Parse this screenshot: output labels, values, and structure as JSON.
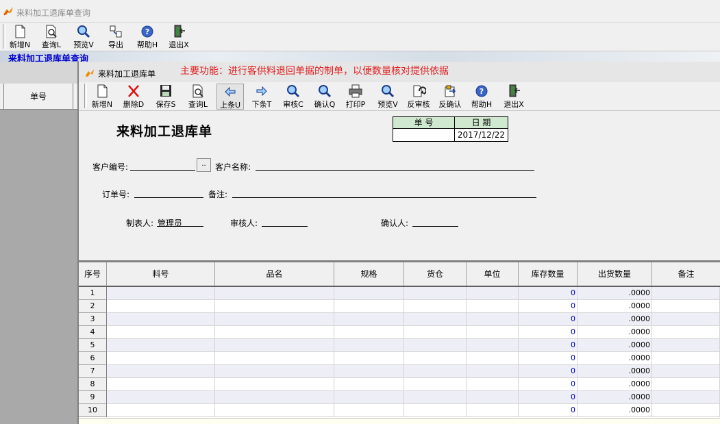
{
  "window": {
    "title": "来料加工退库单查询"
  },
  "outer_toolbar": {
    "buttons": [
      {
        "label": "新增N",
        "icon": "new-document-icon"
      },
      {
        "label": "查询L",
        "icon": "query-document-icon"
      },
      {
        "label": "预览V",
        "icon": "magnifier-icon"
      },
      {
        "label": "导出",
        "icon": "export-icon"
      },
      {
        "label": "帮助H",
        "icon": "help-icon"
      },
      {
        "label": "退出X",
        "icon": "exit-door-icon"
      }
    ]
  },
  "outer_panel": {
    "caption": "来料加工退库单查询",
    "grid_header": "单号"
  },
  "child": {
    "title": "来料加工退库单",
    "function_note": "主要功能：进行客供料退回单据的制单，以便数量核对提供依据",
    "toolbar": {
      "buttons": [
        {
          "label": "新增N",
          "icon": "new-document-icon"
        },
        {
          "label": "删除D",
          "icon": "delete-x-icon"
        },
        {
          "label": "保存S",
          "icon": "save-disk-icon"
        },
        {
          "label": "查询L",
          "icon": "query-document-icon"
        },
        {
          "label": "上条U",
          "icon": "arrow-left-icon"
        },
        {
          "label": "下条T",
          "icon": "arrow-right-icon"
        },
        {
          "label": "审核C",
          "icon": "magnifier-icon"
        },
        {
          "label": "确认Q",
          "icon": "magnifier-icon"
        },
        {
          "label": "打印P",
          "icon": "printer-icon"
        },
        {
          "label": "预览V",
          "icon": "magnifier-icon"
        },
        {
          "label": "反审核",
          "icon": "reverse-audit-icon"
        },
        {
          "label": "反确认",
          "icon": "reverse-confirm-icon"
        },
        {
          "label": "帮助H",
          "icon": "help-icon"
        },
        {
          "label": "退出X",
          "icon": "exit-door-icon"
        }
      ]
    },
    "form": {
      "title": "来料加工退库单",
      "doc_no_label": "单  号",
      "date_label": "日  期",
      "doc_no_value": "",
      "date_value": "2017/12/22",
      "customer_code_label": "客户编号:",
      "customer_code_value": "",
      "browse_label": "..",
      "customer_name_label": "客户名称:",
      "customer_name_value": "",
      "order_no_label": "订单号:",
      "order_no_value": "",
      "remark_label": "备注:",
      "remark_value": "",
      "maker_label": "制表人:",
      "maker_value": "管理员",
      "auditor_label": "审核人:",
      "auditor_value": "",
      "confirmer_label": "确认人:",
      "confirmer_value": ""
    },
    "grid": {
      "columns": [
        "序号",
        "料号",
        "品名",
        "规格",
        "货仓",
        "单位",
        "库存数量",
        "出货数量",
        "备注"
      ],
      "rows": [
        {
          "no": "1",
          "stock": "0",
          "qty": ".0000"
        },
        {
          "no": "2",
          "stock": "0",
          "qty": ".0000"
        },
        {
          "no": "3",
          "stock": "0",
          "qty": ".0000"
        },
        {
          "no": "4",
          "stock": "0",
          "qty": ".0000"
        },
        {
          "no": "5",
          "stock": "0",
          "qty": ".0000"
        },
        {
          "no": "6",
          "stock": "0",
          "qty": ".0000"
        },
        {
          "no": "7",
          "stock": "0",
          "qty": ".0000"
        },
        {
          "no": "8",
          "stock": "0",
          "qty": ".0000"
        },
        {
          "no": "9",
          "stock": "0",
          "qty": ".0000"
        },
        {
          "no": "10",
          "stock": "0",
          "qty": ".0000"
        }
      ]
    }
  },
  "colors": {
    "header_caption": "#0000cc",
    "function_note": "#e02020",
    "stock_value": "#0000cc",
    "date_header_bg": "#cfe8cf"
  }
}
